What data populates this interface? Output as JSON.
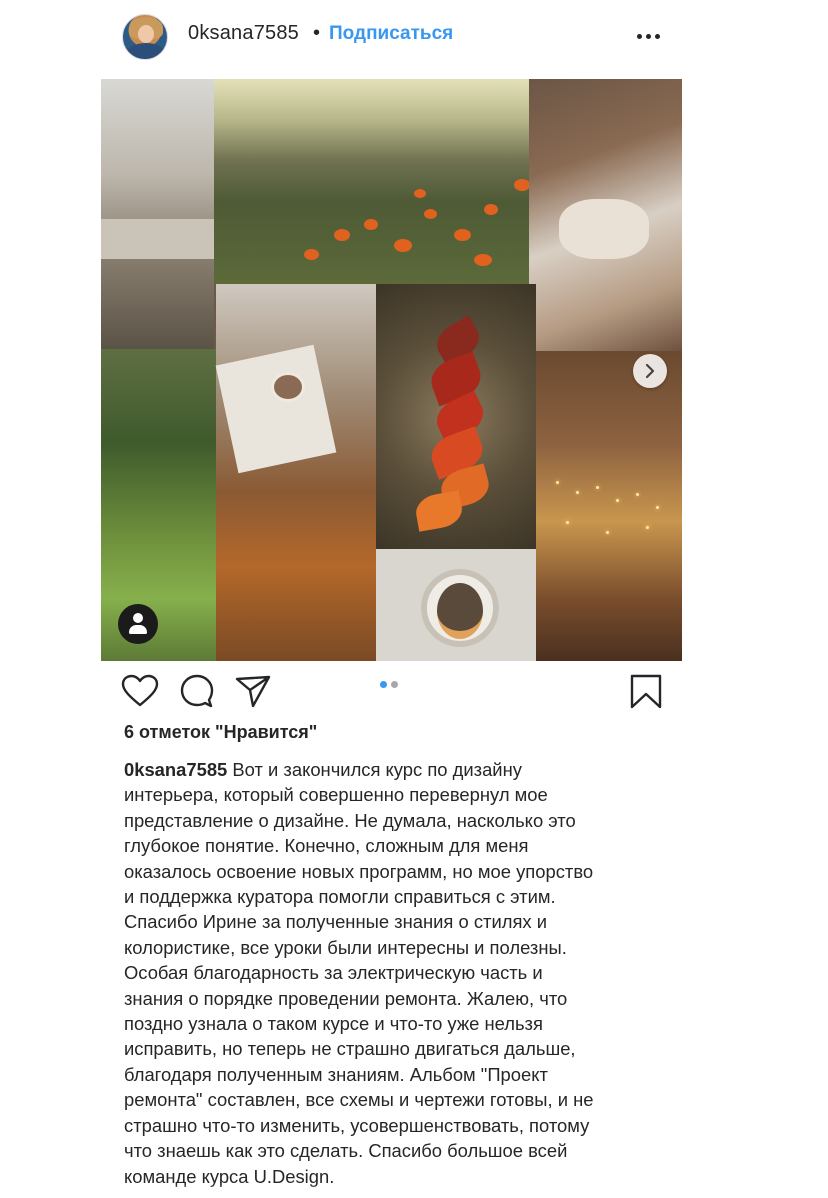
{
  "header": {
    "username": "0ksana7585",
    "separator": "•",
    "follow_label": "Подписаться",
    "more_icon": "more-horizontal-icon"
  },
  "post": {
    "image_description_icons": {
      "user_tag": "person-icon",
      "next": "chevron-right-icon"
    },
    "carousel": {
      "total": 2,
      "active": 0,
      "active_color": "#3897f0",
      "inactive_color": "#a8a8a8"
    }
  },
  "actions": {
    "like_icon": "heart-icon",
    "comment_icon": "comment-icon",
    "share_icon": "send-icon",
    "save_icon": "bookmark-icon"
  },
  "likes_text": "6 отметок \"Нравится\"",
  "caption": {
    "author": "0ksana7585",
    "lines": [
      " Вот и закончился курс по дизайну",
      "интерьера, который совершенно перевернул мое",
      "представление о дизайне. Не думала, насколько это",
      "глубокое понятие. Конечно, сложным для меня",
      "оказалось освоение новых программ, но мое упорство",
      "и поддержка куратора помогли справиться с этим.",
      "Спасибо Ирине за полученные знания о стилях и",
      "колористике, все уроки были интересны и полезны.",
      "Особая благодарность за электрическую часть и",
      "знания о порядке проведении ремонта. Жалею, что",
      "поздно узнала о таком курсе и что-то уже нельзя",
      "исправить, но теперь не страшно двигаться дальше,",
      "благодаря полученным знаниям. Альбом \"Проект",
      "ремонта\" составлен, все схемы и чертежи готовы, и не",
      "страшно что-то изменить, усовершенствовать, потому",
      "что знаешь как это сделать. Спасибо большое всей",
      "команде курса U.Design."
    ]
  },
  "colors": {
    "text": "#262626",
    "link": "#3897f0"
  }
}
